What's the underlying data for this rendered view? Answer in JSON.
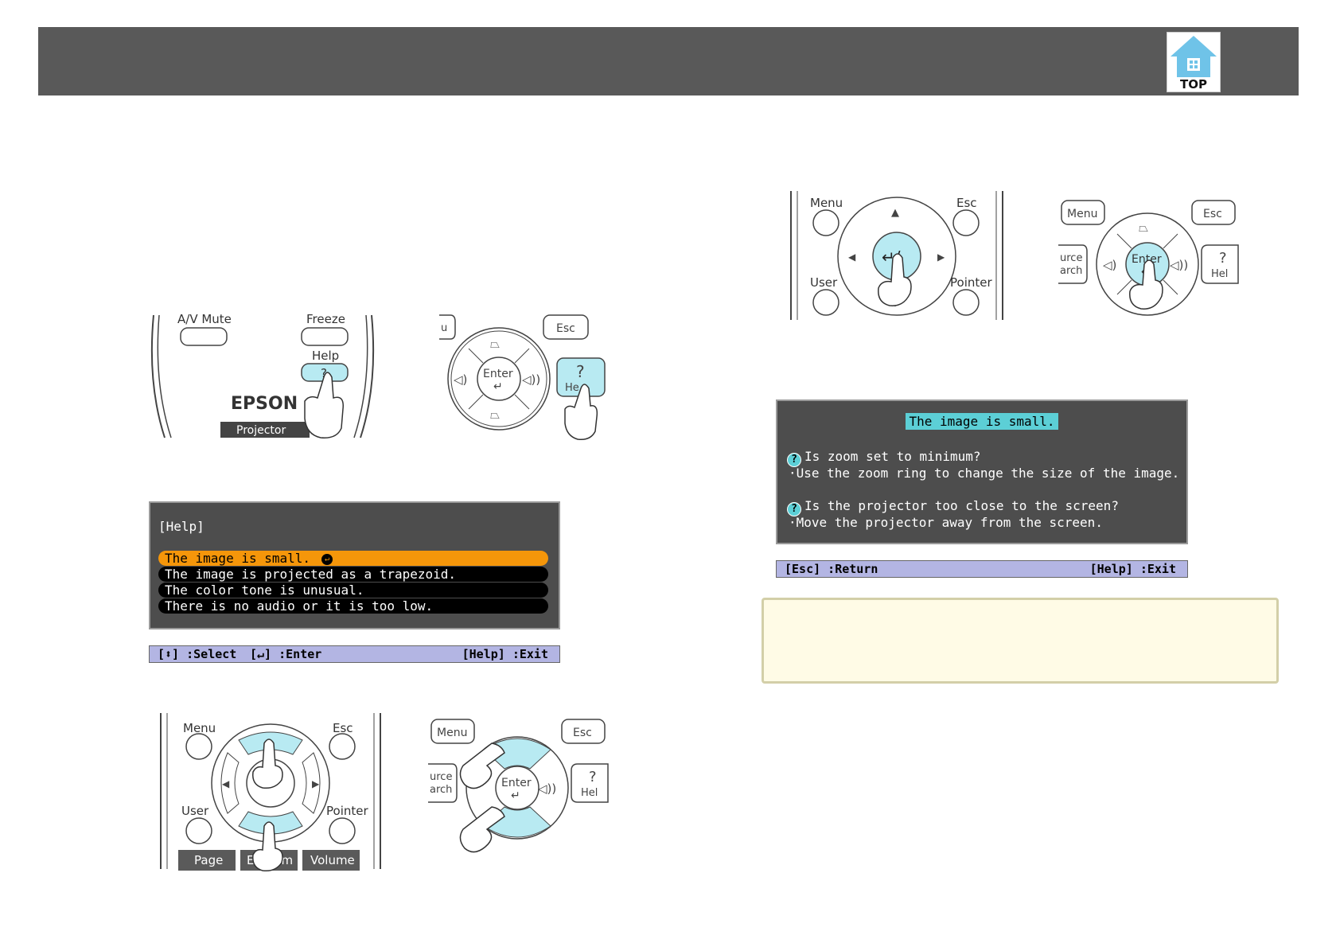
{
  "header": {
    "top_button_label": "TOP"
  },
  "remote_help_step": {
    "av_mute_label": "A/V Mute",
    "freeze_label": "Freeze",
    "help_label": "Help",
    "help_glyph": "?",
    "brand_label": "EPSON",
    "projector_label": "Projector"
  },
  "panel_help_step": {
    "menu_fragment": "u",
    "esc_label": "Esc",
    "enter_label": "Enter",
    "help_fragment": "He",
    "help_glyph": "?"
  },
  "help_menu": {
    "title": "[Help]",
    "items": [
      {
        "label": "The image is small.",
        "selected": true
      },
      {
        "label": "The image is projected as a trapezoid.",
        "selected": false
      },
      {
        "label": "The color tone is unusual.",
        "selected": false
      },
      {
        "label": "There is no audio or it is too low.",
        "selected": false
      }
    ],
    "status_select": "[⬍] :Select",
    "status_enter": "[↵] :Enter",
    "status_exit": "[Help] :Exit"
  },
  "remote_select_step": {
    "menu_label": "Menu",
    "esc_label": "Esc",
    "user_label": "User",
    "pointer_label": "Pointer",
    "page_label": "Page",
    "ezoom_label": "E-Zoom",
    "volume_label": "Volume"
  },
  "panel_select_step": {
    "menu_label": "Menu",
    "esc_label": "Esc",
    "source_fragment_1": "urce",
    "source_fragment_2": "arch",
    "enter_label": "Enter",
    "help_fragment": "Hel",
    "help_glyph": "?"
  },
  "remote_enter_step": {
    "menu_label": "Menu",
    "esc_label": "Esc",
    "user_label": "User",
    "pointer_label": "Pointer"
  },
  "panel_enter_step": {
    "menu_label": "Menu",
    "esc_label": "Esc",
    "source_fragment_1": "urce",
    "source_fragment_2": "arch",
    "enter_label": "Enter",
    "help_fragment": "Hel",
    "help_glyph": "?"
  },
  "help_detail": {
    "title": "The image is small.",
    "q1": "Is zoom set to minimum?",
    "a1": "·Use the zoom ring to change the size of the image.",
    "q2": "Is the projector too close to the screen?",
    "a2": "·Move the projector away from the screen.",
    "status_return": "[Esc] :Return",
    "status_exit": "[Help] :Exit"
  },
  "colors": {
    "header_bar": "#595959",
    "highlight_button": "#b8eaf2",
    "osd_background": "#4d4d4d",
    "selected_item": "#f5960a",
    "status_bar": "#b3b5e3",
    "note_background": "#fffbe6"
  }
}
